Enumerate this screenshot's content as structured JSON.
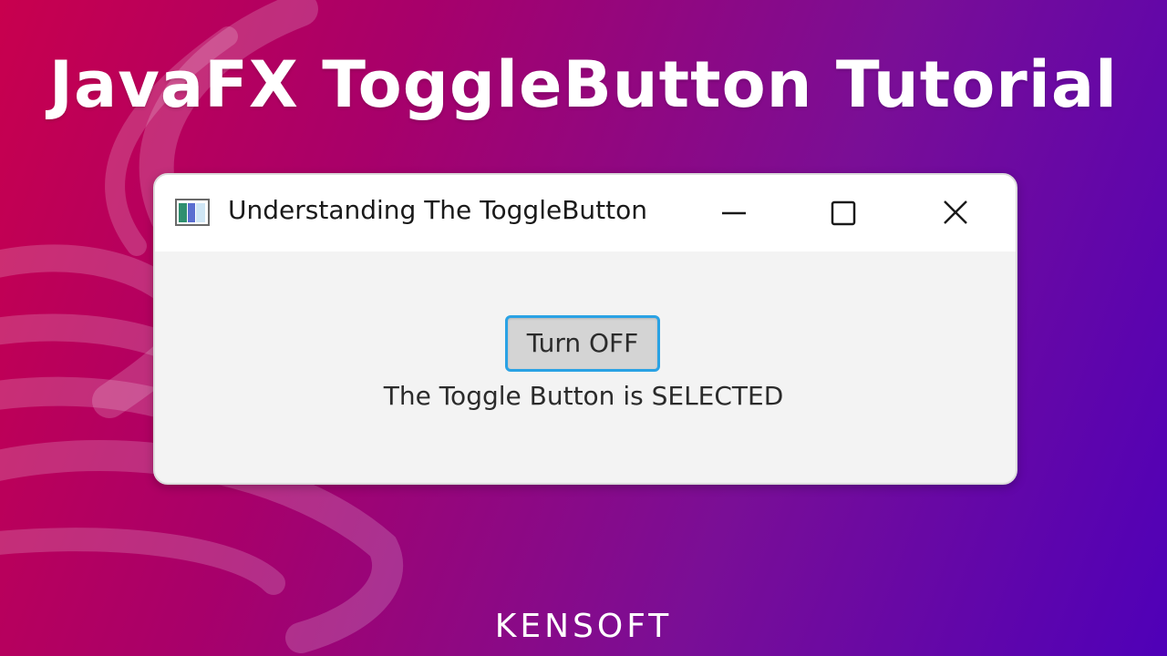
{
  "headline": "JavaFX ToggleButton Tutorial",
  "window": {
    "title": "Understanding The ToggleButton",
    "minimize_icon": "minimize-icon",
    "maximize_icon": "maximize-icon",
    "close_icon": "close-icon",
    "app_icon": "app-window-icon"
  },
  "toggle_button": {
    "label": "Turn OFF",
    "selected": true
  },
  "status": {
    "text": "The Toggle Button is SELECTED"
  },
  "brand": {
    "logo_text": "KENSOFT"
  },
  "colors": {
    "background_start": "#c8004e",
    "background_end": "#4f00b8",
    "focus_border": "#2aa2e4",
    "button_selected": "#d4d4d4",
    "window_body": "#f3f3f3"
  }
}
